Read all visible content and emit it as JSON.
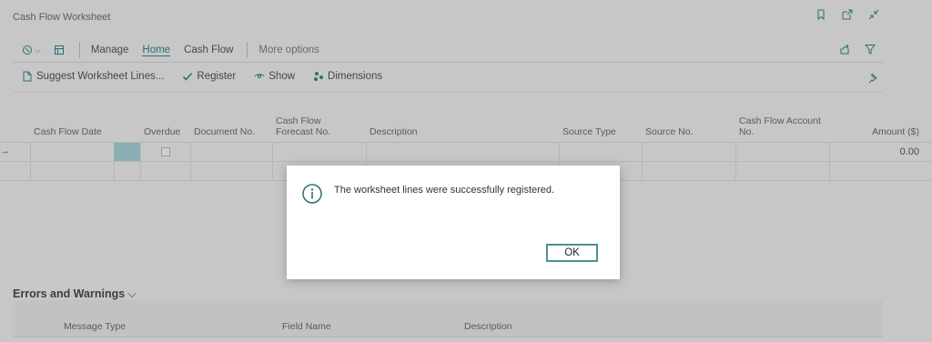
{
  "window": {
    "title": "Cash Flow Worksheet",
    "title_icons": [
      "bookmark-icon",
      "open-new-window-icon",
      "collapse-icon"
    ]
  },
  "actionbar": {
    "menus": [
      "Manage",
      "Home",
      "Cash Flow"
    ],
    "active_menu": "Home",
    "more": "More options",
    "right_icons": [
      "share-icon",
      "filter-icon"
    ]
  },
  "promoted_actions": [
    {
      "label": "Suggest Worksheet Lines...",
      "icon": "suggest-icon"
    },
    {
      "label": "Register",
      "icon": "check-icon"
    },
    {
      "label": "Show",
      "icon": "eye-icon"
    },
    {
      "label": "Dimensions",
      "icon": "dimensions-icon"
    }
  ],
  "grid": {
    "columns": [
      "Cash Flow Date",
      "Overdue",
      "Document No.",
      "Cash Flow Forecast No.",
      "Description",
      "Source Type",
      "Source No.",
      "Cash Flow Account No.",
      "Amount ($)"
    ],
    "rows": [
      {
        "amount": "0.00"
      },
      {
        "amount": ""
      }
    ]
  },
  "errors_section": {
    "title": "Errors and Warnings",
    "columns": [
      "Message Type",
      "Field Name",
      "Description"
    ]
  },
  "dialog": {
    "message": "The worksheet lines were successfully registered.",
    "ok_label": "OK"
  },
  "colors": {
    "accent": "#2c6f73",
    "selected_cell": "#8ab0b4"
  }
}
